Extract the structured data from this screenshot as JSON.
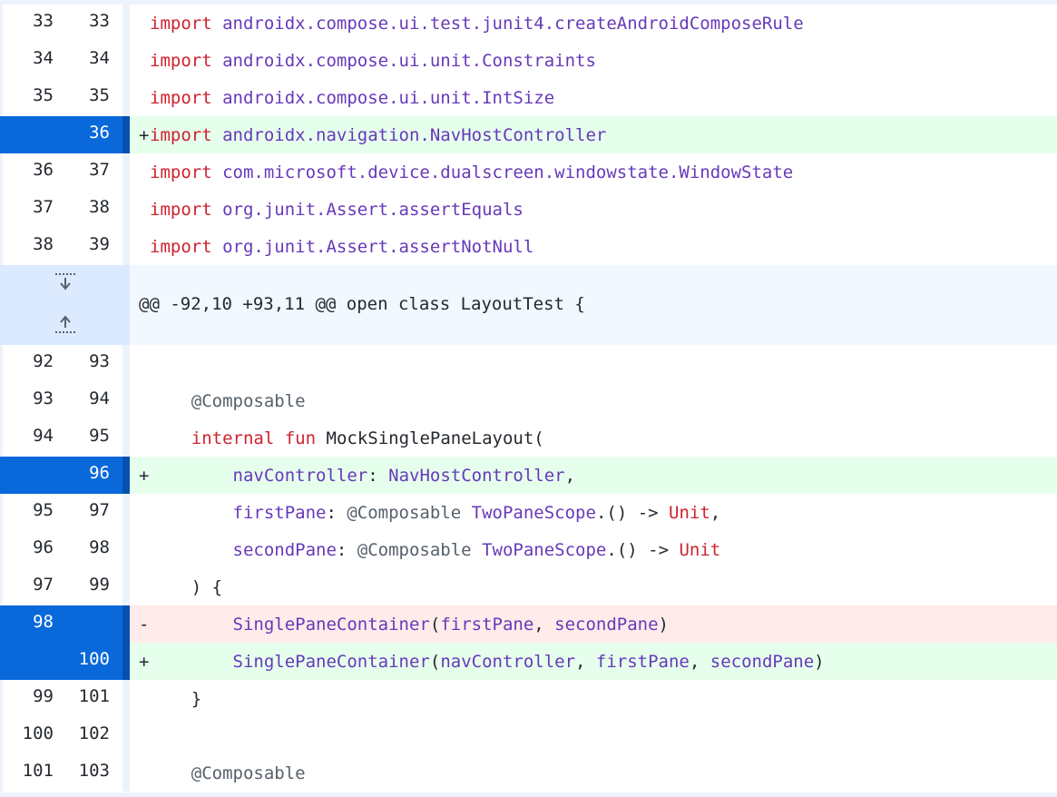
{
  "hunk_header": "@@ -92,10 +93,11 @@ open class LayoutTest {",
  "rows": [
    {
      "type": "ctx",
      "old": "33",
      "new": "33",
      "marker": "",
      "indent": 0,
      "tokens": [
        [
          "k",
          "import"
        ],
        [
          "d",
          " "
        ],
        [
          "p",
          "androidx.compose.ui.test.junit4.createAndroidComposeRule"
        ]
      ]
    },
    {
      "type": "ctx",
      "old": "34",
      "new": "34",
      "marker": "",
      "indent": 0,
      "tokens": [
        [
          "k",
          "import"
        ],
        [
          "d",
          " "
        ],
        [
          "p",
          "androidx.compose.ui.unit.Constraints"
        ]
      ]
    },
    {
      "type": "ctx",
      "old": "35",
      "new": "35",
      "marker": "",
      "indent": 0,
      "tokens": [
        [
          "k",
          "import"
        ],
        [
          "d",
          " "
        ],
        [
          "p",
          "androidx.compose.ui.unit.IntSize"
        ]
      ]
    },
    {
      "type": "add",
      "sel": true,
      "old": "",
      "new": "36",
      "marker": "+",
      "indent": 0,
      "tokens": [
        [
          "k",
          "import"
        ],
        [
          "d",
          " "
        ],
        [
          "p",
          "androidx.navigation.NavHostController"
        ]
      ]
    },
    {
      "type": "ctx",
      "old": "36",
      "new": "37",
      "marker": "",
      "indent": 0,
      "tokens": [
        [
          "k",
          "import"
        ],
        [
          "d",
          " "
        ],
        [
          "p",
          "com.microsoft.device.dualscreen.windowstate.WindowState"
        ]
      ]
    },
    {
      "type": "ctx",
      "old": "37",
      "new": "38",
      "marker": "",
      "indent": 0,
      "tokens": [
        [
          "k",
          "import"
        ],
        [
          "d",
          " "
        ],
        [
          "p",
          "org.junit.Assert.assertEquals"
        ]
      ]
    },
    {
      "type": "ctx",
      "old": "38",
      "new": "39",
      "marker": "",
      "indent": 0,
      "tokens": [
        [
          "k",
          "import"
        ],
        [
          "d",
          " "
        ],
        [
          "p",
          "org.junit.Assert.assertNotNull"
        ]
      ]
    },
    {
      "type": "hunk"
    },
    {
      "type": "ctx",
      "old": "92",
      "new": "93",
      "marker": "",
      "indent": 0,
      "tokens": []
    },
    {
      "type": "ctx",
      "old": "93",
      "new": "94",
      "marker": "",
      "indent": 4,
      "tokens": [
        [
          "a",
          "@Composable"
        ]
      ]
    },
    {
      "type": "ctx",
      "old": "94",
      "new": "95",
      "marker": "",
      "indent": 4,
      "tokens": [
        [
          "k",
          "internal"
        ],
        [
          "d",
          " "
        ],
        [
          "k",
          "fun"
        ],
        [
          "d",
          " MockSinglePaneLayout("
        ]
      ]
    },
    {
      "type": "add",
      "sel": true,
      "old": "",
      "new": "96",
      "marker": "+",
      "indent": 8,
      "tokens": [
        [
          "p",
          "navController"
        ],
        [
          "d",
          ": "
        ],
        [
          "p",
          "NavHostController"
        ],
        [
          "d",
          ","
        ]
      ]
    },
    {
      "type": "ctx",
      "old": "95",
      "new": "97",
      "marker": "",
      "indent": 8,
      "tokens": [
        [
          "p",
          "firstPane"
        ],
        [
          "d",
          ": "
        ],
        [
          "a",
          "@Composable"
        ],
        [
          "d",
          " "
        ],
        [
          "p",
          "TwoPaneScope"
        ],
        [
          "d",
          ".() -> "
        ],
        [
          "k",
          "Unit"
        ],
        [
          "d",
          ","
        ]
      ]
    },
    {
      "type": "ctx",
      "old": "96",
      "new": "98",
      "marker": "",
      "indent": 8,
      "tokens": [
        [
          "p",
          "secondPane"
        ],
        [
          "d",
          ": "
        ],
        [
          "a",
          "@Composable"
        ],
        [
          "d",
          " "
        ],
        [
          "p",
          "TwoPaneScope"
        ],
        [
          "d",
          ".() -> "
        ],
        [
          "k",
          "Unit"
        ]
      ]
    },
    {
      "type": "ctx",
      "old": "97",
      "new": "99",
      "marker": "",
      "indent": 4,
      "tokens": [
        [
          "d",
          ") {"
        ]
      ]
    },
    {
      "type": "del",
      "sel": true,
      "old": "98",
      "new": "",
      "marker": "-",
      "indent": 8,
      "tokens": [
        [
          "p",
          "SinglePaneContainer"
        ],
        [
          "d",
          "("
        ],
        [
          "p",
          "firstPane"
        ],
        [
          "d",
          ", "
        ],
        [
          "p",
          "secondPane"
        ],
        [
          "d",
          ")"
        ]
      ]
    },
    {
      "type": "add",
      "sel": true,
      "old": "",
      "new": "100",
      "marker": "+",
      "indent": 8,
      "tokens": [
        [
          "p",
          "SinglePaneContainer"
        ],
        [
          "d",
          "("
        ],
        [
          "p",
          "navController"
        ],
        [
          "d",
          ", "
        ],
        [
          "p",
          "firstPane"
        ],
        [
          "d",
          ", "
        ],
        [
          "p",
          "secondPane"
        ],
        [
          "d",
          ")"
        ]
      ]
    },
    {
      "type": "ctx",
      "old": "99",
      "new": "101",
      "marker": "",
      "indent": 4,
      "tokens": [
        [
          "d",
          "}"
        ]
      ]
    },
    {
      "type": "ctx",
      "old": "100",
      "new": "102",
      "marker": "",
      "indent": 0,
      "tokens": []
    },
    {
      "type": "ctx",
      "old": "101",
      "new": "103",
      "marker": "",
      "indent": 4,
      "tokens": [
        [
          "a",
          "@Composable"
        ]
      ]
    }
  ],
  "icons": {
    "expand_down": "expand-down-icon",
    "expand_up": "expand-up-icon"
  },
  "colors": {
    "added_bg": "#e6ffec",
    "deleted_bg": "#ffebe9",
    "selected_num_bg": "#0969da",
    "keyword": "#cf222e",
    "identifier": "#6639ba"
  }
}
